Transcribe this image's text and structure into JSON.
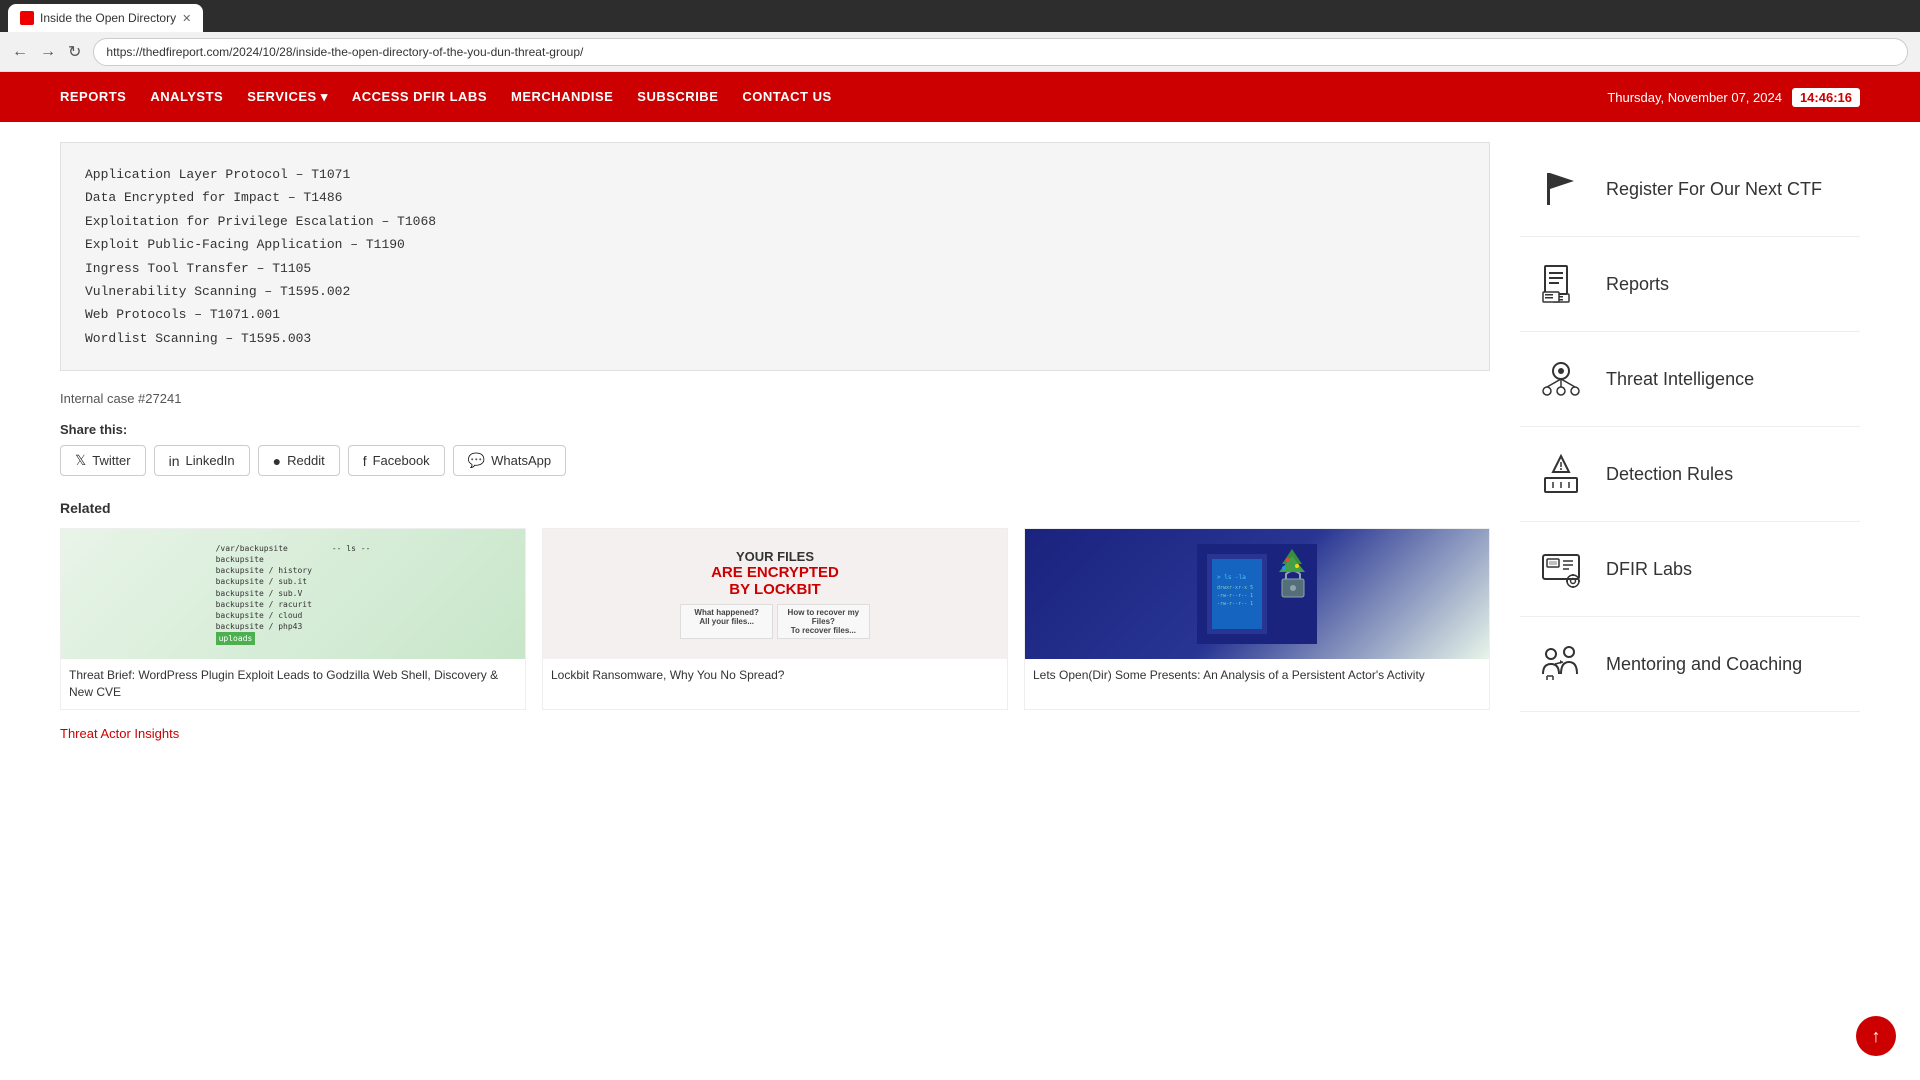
{
  "browser": {
    "tab_title": "Inside the Open Directory",
    "url": "https://thedfireport.com/2024/10/28/inside-the-open-directory-of-the-you-dun-threat-group/"
  },
  "nav": {
    "links": [
      "REPORTS",
      "ANALYSTS",
      "SERVICES",
      "ACCESS DFIR LABS",
      "MERCHANDISE",
      "SUBSCRIBE",
      "CONTACT US"
    ],
    "date": "Thursday, November 07, 2024",
    "time": "14:46:16"
  },
  "content": {
    "code_lines": [
      "Application Layer Protocol – T1071",
      "Data Encrypted for Impact – T1486",
      "Exploitation for Privilege Escalation – T1068",
      "Exploit Public-Facing Application – T1190",
      "Ingress Tool Transfer – T1105",
      "Vulnerability Scanning – T1595.002",
      "Web Protocols – T1071.001",
      "Wordlist Scanning – T1595.003"
    ],
    "internal_case": "Internal case #27241",
    "share_label": "Share this:",
    "share_buttons": [
      "Twitter",
      "LinkedIn",
      "Reddit",
      "Facebook",
      "WhatsApp"
    ],
    "related_label": "Related",
    "related_cards": [
      {
        "title": "Threat Brief: WordPress Plugin Exploit Leads to Godzilla Web Shell, Discovery & New CVE"
      },
      {
        "title": "Lockbit Ransomware, Why You No Spread?"
      },
      {
        "title": "Lets Open(Dir) Some Presents: An Analysis of a Persistent Actor's Activity"
      }
    ],
    "threat_actor_link": "Threat Actor Insights"
  },
  "sidebar": {
    "items": [
      {
        "label": "Register For Our Next CTF",
        "icon": "flag"
      },
      {
        "label": "Reports",
        "icon": "reports"
      },
      {
        "label": "Threat Intelligence",
        "icon": "threat-intel"
      },
      {
        "label": "Detection Rules",
        "icon": "detection-rules"
      },
      {
        "label": "DFIR Labs",
        "icon": "dfir-labs"
      },
      {
        "label": "Mentoring and Coaching",
        "icon": "mentoring"
      }
    ]
  },
  "scroll_top_label": "↑"
}
